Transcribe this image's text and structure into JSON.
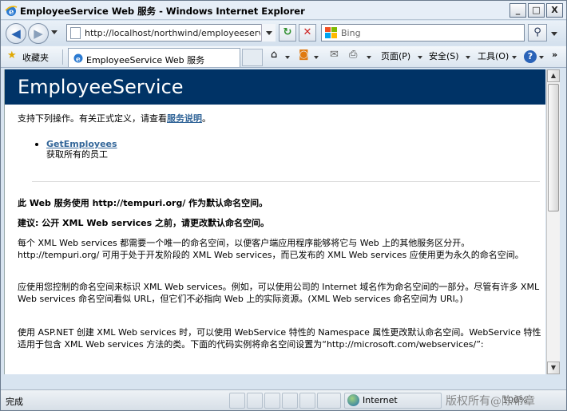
{
  "window": {
    "title": "EmployeeService Web 服务 - Windows Internet Explorer",
    "buttons": {
      "minimize": "_",
      "maximize": "□",
      "close": "X"
    }
  },
  "nav": {
    "url": "http://localhost/northwind/employeeservice.a",
    "search_placeholder": "Bing"
  },
  "favorites": {
    "label": "收藏夹",
    "tab_title": "EmployeeService Web 服务"
  },
  "commandbar": {
    "page_label": "页面(P)",
    "safety_label": "安全(S)",
    "tools_label": "工具(O)",
    "help_glyph": "?"
  },
  "page": {
    "service_name": "EmployeeService",
    "intro_prefix": "支持下列操作。有关正式定义，请查看",
    "intro_link": "服务说明",
    "intro_suffix": "。",
    "operation_name": "GetEmployees",
    "operation_desc": "获取所有的员工",
    "ns_heading": "此 Web 服务使用 http://tempuri.org/ 作为默认命名空间。",
    "advice_heading": "建议: 公开 XML Web services 之前，请更改默认命名空间。",
    "para1": "每个 XML Web services 都需要一个唯一的命名空间，以便客户端应用程序能够将它与 Web 上的其他服务区分开。http://tempuri.org/ 可用于处于开发阶段的 XML Web services，而已发布的 XML Web services 应使用更为永久的命名空间。",
    "para2": "应使用您控制的命名空间来标识 XML Web services。例如，可以使用公司的 Internet 域名作为命名空间的一部分。尽管有许多 XML Web services 命名空间看似 URL，但它们不必指向 Web 上的实际资源。(XML Web services 命名空间为 URI。)",
    "para3": "使用 ASP.NET 创建 XML Web services 时，可以使用 WebService 特性的 Namespace 属性更改默认命名空间。WebService 特性适用于包含 XML Web services 方法的类。下面的代码实例将命名空间设置为“http://microsoft.com/webservices/”:"
  },
  "status": {
    "text": "完成",
    "zone": "Internet",
    "zoom": "100%",
    "watermark": "版权所有@陈希章"
  },
  "colors": {
    "header_band": "#003366",
    "link": "#336699"
  }
}
